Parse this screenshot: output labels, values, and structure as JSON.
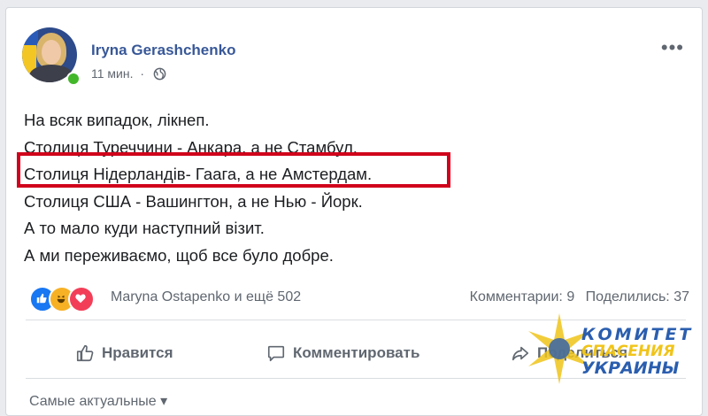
{
  "post": {
    "author": "Iryna Gerashchenko",
    "time": "11 мин.",
    "separator": "·",
    "more_label": "•••",
    "lines": [
      "На всяк випадок, лікнеп.",
      "Столиця Туреччини - Анкара, а не Стамбул.",
      "Столиця Нідерландів- Гаага, а не Амстердам.",
      "Столиця США - Вашингтон, а не Нью - Йорк.",
      "А то мало куди наступний візит.",
      "А ми переживаємо, щоб все було добре."
    ],
    "highlight_color": "#d0021b"
  },
  "engagement": {
    "reactors": "Maryna Ostapenko и ещё 502",
    "comments": "Комментарии: 9",
    "shares": "Поделились: 37",
    "reaction_icons": [
      "like-icon",
      "haha-icon",
      "love-icon"
    ]
  },
  "actions": {
    "like": "Нравится",
    "comment": "Комментировать",
    "share": "Поделиться"
  },
  "bottom": {
    "text": "Самые актуальные ▾"
  },
  "watermark": {
    "line1": "КОМИТЕТ",
    "line2": "СПАСЕНИЯ",
    "line3": "УКРАИНЫ"
  },
  "colors": {
    "link": "#385898",
    "like": "#1877f2",
    "haha": "#f7b125",
    "love": "#f33e58",
    "online": "#42b72a"
  }
}
